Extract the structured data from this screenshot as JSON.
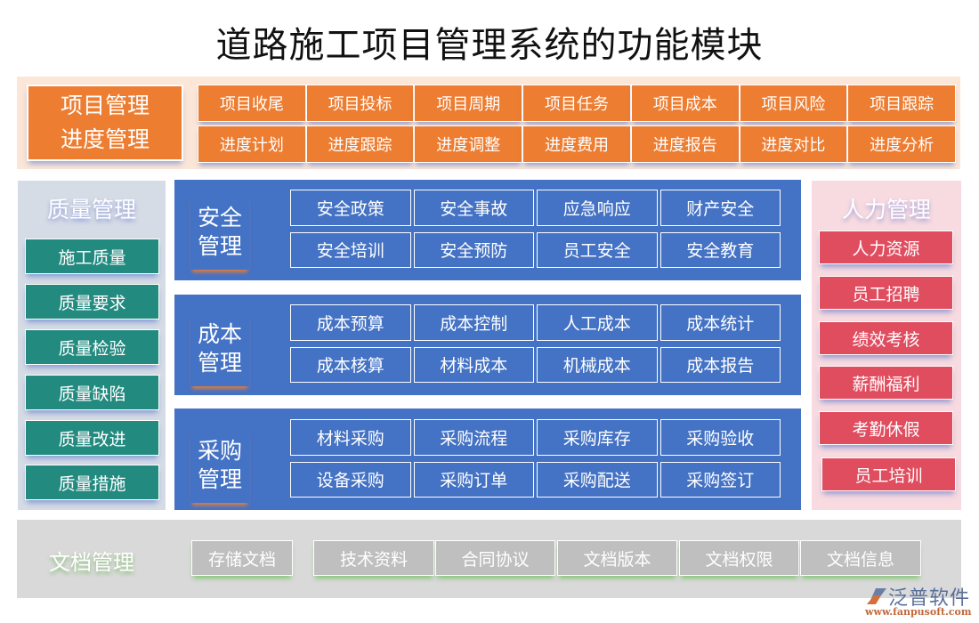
{
  "title": "道路施工项目管理系统的功能模块",
  "colors": {
    "orange": "#ed7d31",
    "teal": "#238a80",
    "blue": "#4472c4",
    "red": "#e04d5f",
    "gray": "#bfbfbf"
  },
  "project": {
    "label_line1": "项目管理",
    "label_line2": "进度管理",
    "row1": [
      "项目收尾",
      "项目投标",
      "项目周期",
      "项目任务",
      "项目成本",
      "项目风险",
      "项目跟踪"
    ],
    "row2": [
      "进度计划",
      "进度跟踪",
      "进度调整",
      "进度费用",
      "进度报告",
      "进度对比",
      "进度分析"
    ]
  },
  "quality": {
    "title": "质量管理",
    "items": [
      "施工质量",
      "质量要求",
      "质量检验",
      "质量缺陷",
      "质量改进",
      "质量措施"
    ]
  },
  "safety": {
    "label_line1": "安全",
    "label_line2": "管理",
    "items": [
      "安全政策",
      "安全事故",
      "应急响应",
      "财产安全",
      "安全培训",
      "安全预防",
      "员工安全",
      "安全教育"
    ]
  },
  "cost": {
    "label_line1": "成本",
    "label_line2": "管理",
    "items": [
      "成本预算",
      "成本控制",
      "人工成本",
      "成本统计",
      "成本核算",
      "材料成本",
      "机械成本",
      "成本报告"
    ]
  },
  "purchase": {
    "label_line1": "采购",
    "label_line2": "管理",
    "items": [
      "材料采购",
      "采购流程",
      "采购库存",
      "采购验收",
      "设备采购",
      "采购订单",
      "采购配送",
      "采购签订"
    ]
  },
  "hr": {
    "title": "人力管理",
    "items": [
      "人力资源",
      "员工招聘",
      "绩效考核",
      "薪酬福利",
      "考勤休假",
      "员工培训"
    ]
  },
  "docs": {
    "title": "文档管理",
    "items": [
      "存储文档",
      "技术资料",
      "合同协议",
      "文档版本",
      "文档权限",
      "文档信息"
    ]
  },
  "logo": {
    "name": "泛普软件",
    "url": "www.fanpusoft.com",
    "icon": "fanpu-logo-icon"
  }
}
